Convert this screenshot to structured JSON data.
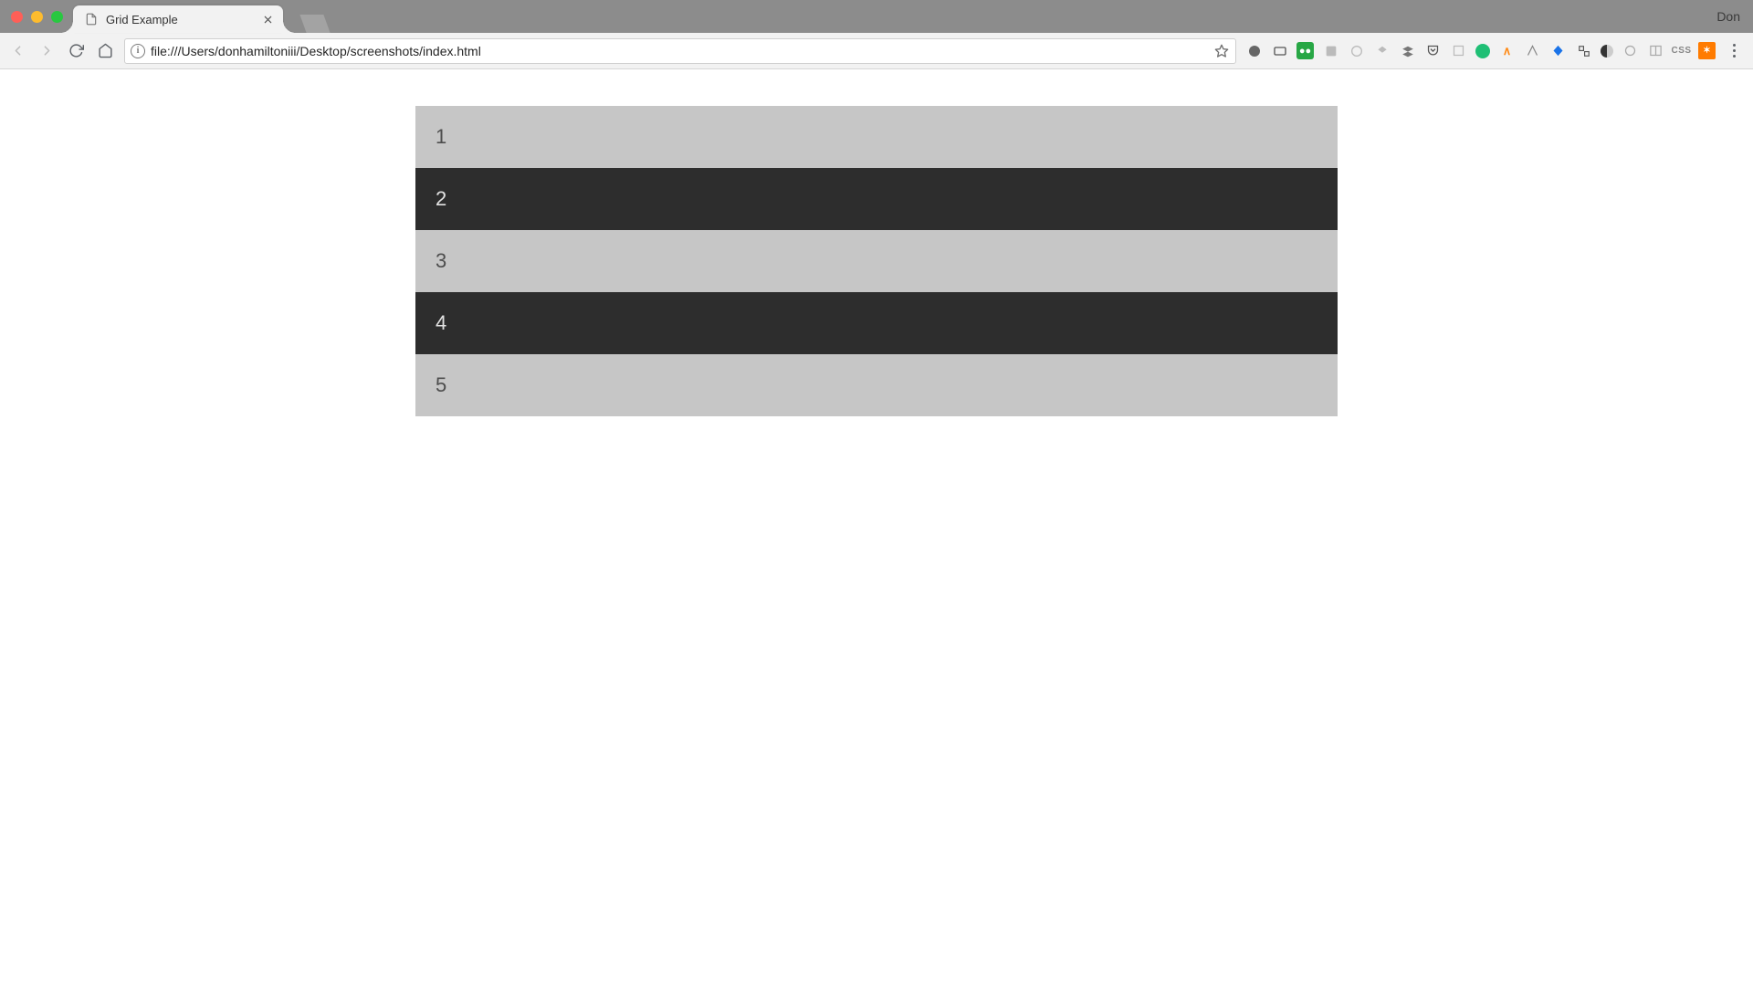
{
  "window": {
    "profile_name": "Don"
  },
  "tab": {
    "title": "Grid Example"
  },
  "address_bar": {
    "url": "file:///Users/donhamiltoniii/Desktop/screenshots/index.html"
  },
  "extensions": {
    "css_label": "CSS"
  },
  "page": {
    "rows": [
      {
        "label": "1"
      },
      {
        "label": "2"
      },
      {
        "label": "3"
      },
      {
        "label": "4"
      },
      {
        "label": "5"
      }
    ]
  }
}
